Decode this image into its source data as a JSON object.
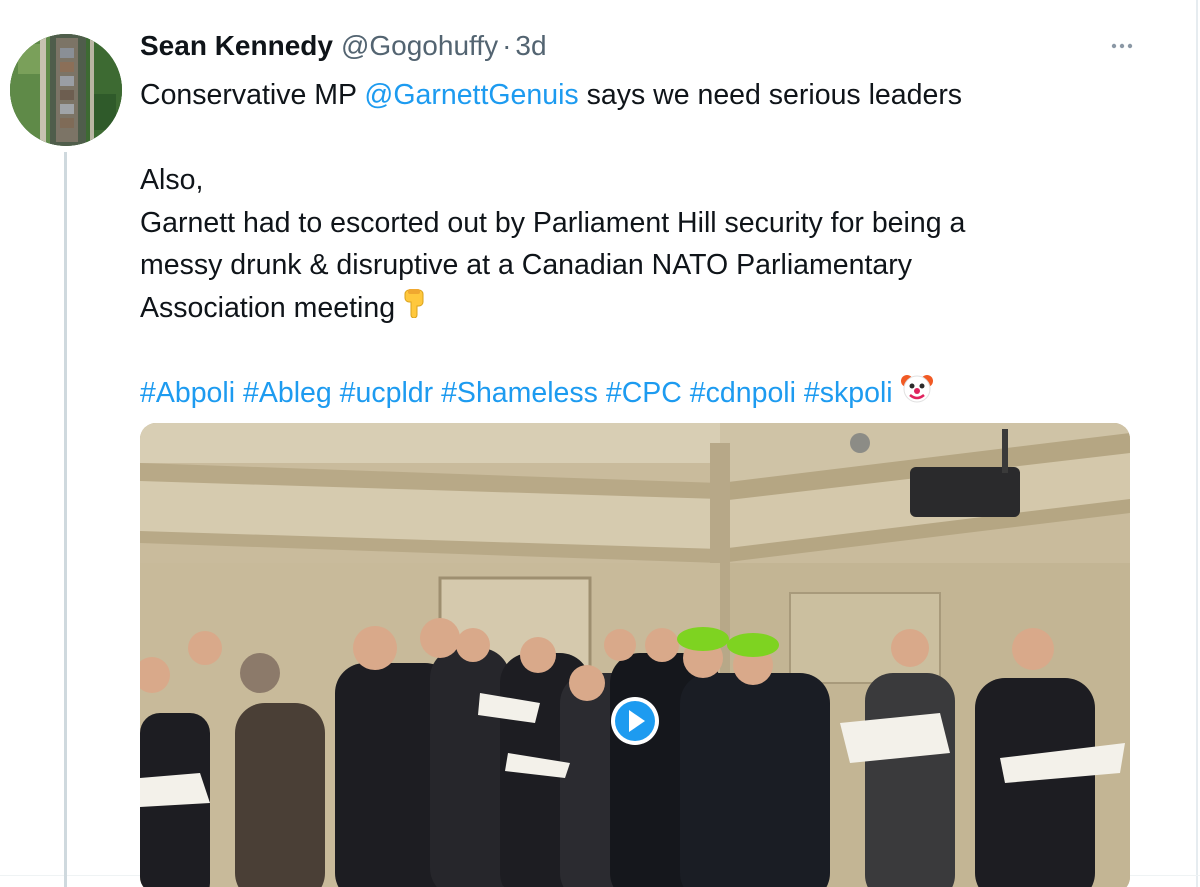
{
  "tweet": {
    "author_name": "Sean Kennedy",
    "author_handle": "@Gogohuffy",
    "separator": "·",
    "timestamp": "3d",
    "text_line1_before": "Conservative MP ",
    "mention": "@GarnettGenuis",
    "text_line1_after": " says we need serious leaders",
    "text_line2": "Also,",
    "text_line3": "Garnett had to escorted out by Parliament Hill security for being  a",
    "text_line4": "messy drunk & disruptive at a Canadian NATO Parliamentary",
    "text_line5": "Association meeting",
    "hashtags": [
      "#Abpoli",
      "#Ableg",
      "#ucpldr",
      "#Shameless",
      "#CPC",
      "#cdnpoli",
      "#skpoli"
    ],
    "emojis": {
      "pointing": "pointing-down-emoji",
      "clown": "clown-face-emoji"
    }
  },
  "icons": {
    "avatar": "avatar-ship-aerial",
    "more": "more-options-icon",
    "play": "play-icon"
  },
  "colors": {
    "text": "#0f1419",
    "secondary": "#536471",
    "link": "#1d9bf0",
    "thread_line": "#cfd9de"
  }
}
